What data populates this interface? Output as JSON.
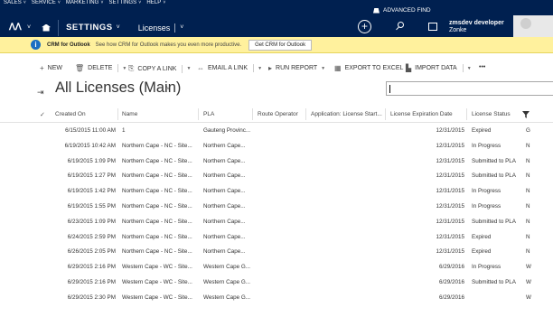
{
  "menu": [
    "SALES",
    "SERVICE",
    "MARKETING",
    "SETTINGS",
    "HELP"
  ],
  "advanced_find": "ADVANCED FIND",
  "nav": {
    "settings": "SETTINGS",
    "entity": "Licenses"
  },
  "user": {
    "name": "zmsdev developer",
    "org": "Zonke"
  },
  "notification": {
    "title": "CRM for Outlook",
    "message": "See how CRM for Outlook makes you even more productive.",
    "button": "Get CRM for Outlook"
  },
  "commands": {
    "new": "NEW",
    "delete": "DELETE",
    "copy_link": "COPY A LINK",
    "email_link": "EMAIL A LINK",
    "run_report": "RUN REPORT",
    "export_excel": "EXPORT TO EXCEL",
    "import_data": "IMPORT DATA",
    "more": "•••"
  },
  "view": {
    "title": "All Licenses (Main)"
  },
  "columns": [
    "Created On",
    "Name",
    "PLA",
    "Route Operator",
    "Application: License Start...",
    "License Expiration Date",
    "License Status"
  ],
  "rows": [
    {
      "created": "6/15/2015 11:00 AM",
      "name": "1",
      "pla": "Gauteng Provinc...",
      "expiry": "12/31/2015",
      "status": "Expired",
      "extra": "G"
    },
    {
      "created": "6/19/2015 10:42 AM",
      "name": "Northern Cape - NC - Site...",
      "pla": "Northern Cape...",
      "expiry": "12/31/2015",
      "status": "In Progress",
      "extra": "N"
    },
    {
      "created": "6/19/2015 1:09 PM",
      "name": "Northern Cape - NC - Site...",
      "pla": "Northern Cape...",
      "expiry": "12/31/2015",
      "status": "Submitted to PLA",
      "extra": "N"
    },
    {
      "created": "6/19/2015 1:27 PM",
      "name": "Northern Cape - NC - Site...",
      "pla": "Northern Cape...",
      "expiry": "12/31/2015",
      "status": "Submitted to PLA",
      "extra": "N"
    },
    {
      "created": "6/19/2015 1:42 PM",
      "name": "Northern Cape - NC - Site...",
      "pla": "Northern Cape...",
      "expiry": "12/31/2015",
      "status": "In Progress",
      "extra": "N"
    },
    {
      "created": "6/19/2015 1:55 PM",
      "name": "Northern Cape - NC - Site...",
      "pla": "Northern Cape...",
      "expiry": "12/31/2015",
      "status": "In Progress",
      "extra": "N"
    },
    {
      "created": "6/23/2015 1:09 PM",
      "name": "Northern Cape - NC - Site...",
      "pla": "Northern Cape...",
      "expiry": "12/31/2015",
      "status": "Submitted to PLA",
      "extra": "N"
    },
    {
      "created": "6/24/2015 2:59 PM",
      "name": "Northern Cape - NC - Site...",
      "pla": "Northern Cape...",
      "expiry": "12/31/2015",
      "status": "Expired",
      "extra": "N"
    },
    {
      "created": "6/26/2015 2:05 PM",
      "name": "Northern Cape - NC - Site...",
      "pla": "Northern Cape...",
      "expiry": "12/31/2015",
      "status": "Expired",
      "extra": "N"
    },
    {
      "created": "6/29/2015 2:16 PM",
      "name": "Western Cape - WC - Site...",
      "pla": "Western Cape G...",
      "expiry": "6/29/2016",
      "status": "In Progress",
      "extra": "W"
    },
    {
      "created": "6/29/2015 2:16 PM",
      "name": "Western Cape - WC - Site...",
      "pla": "Western Cape G...",
      "expiry": "6/29/2016",
      "status": "Submitted to PLA",
      "extra": "W"
    },
    {
      "created": "6/29/2015 2:30 PM",
      "name": "Western Cape - WC - Site...",
      "pla": "Western Cape G...",
      "expiry": "6/29/2016",
      "status": "",
      "extra": "W"
    }
  ]
}
